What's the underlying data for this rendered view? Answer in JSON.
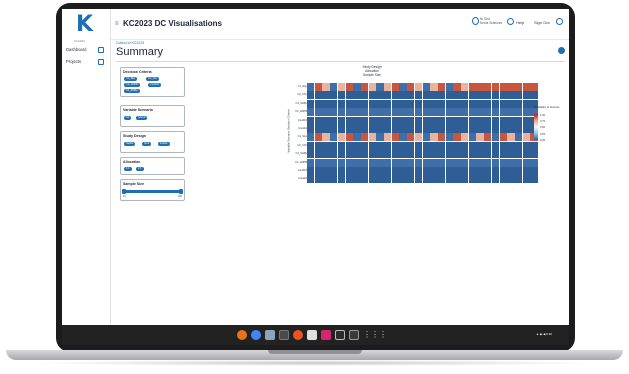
{
  "app": {
    "title": "KC2023 DC Visualisations",
    "logo_subtitle": "KC2023",
    "logo_letter": "K"
  },
  "nav": [
    {
      "label": "Dashboard",
      "icon": "grid-icon"
    },
    {
      "label": "Projects",
      "icon": "folder-icon"
    }
  ],
  "header": {
    "user_name": "Ni Gha",
    "user_org": "Kerva Sciences",
    "help_label": "Help",
    "signout_label": "Sign Out"
  },
  "breadcrumb": "Collect to KC2023",
  "page_title": "Summary",
  "filters": {
    "decision_criteria": {
      "title": "Decision Criteria",
      "chips": [
        "C1_Bkp",
        "C2_Ctb",
        "C3_ADPB",
        "Cond10",
        "C4_RDBp"
      ]
    },
    "variable_scenario": {
      "title": "Variable Scenario",
      "chips": [
        "S1",
        "Scen2"
      ]
    },
    "study_design": {
      "title": "Study Design",
      "chips": [
        "Subtle",
        "Vin1",
        "Fssfss"
      ]
    },
    "allocation": {
      "title": "Allocation",
      "chips": [
        "1:1",
        "2:1"
      ]
    },
    "sample_size": {
      "title": "Sample Size",
      "min": "10",
      "max": "100",
      "range_fraction": [
        0.0,
        1.0
      ]
    }
  },
  "heatmap": {
    "title_lines": [
      "Study Design",
      "Allocation",
      "Sample Size"
    ],
    "y_axis_label": "Variable Scenario Decision Criteria",
    "legend_title": "Probability of Success",
    "legend_ticks": [
      "1.00",
      "0.75",
      "0.50",
      "0.25",
      "0.00"
    ],
    "row_labels": [
      "C1_SLp",
      "C2_CTp",
      "C3_SHPp",
      "C4_ADPB",
      "Cond10",
      "Cond11",
      "C1_SLp",
      "C2_CTp",
      "C3_SHPp",
      "C4_ADPB",
      "Cond10",
      "Cond11"
    ],
    "colors": {
      "high": "#c8553d",
      "mid": "#e8b4a0",
      "low": "#3f6fa8",
      "lowdark": "#2f5d96"
    }
  },
  "taskbar": {
    "tray_text": "▲ ◆ ◀ 6:30"
  }
}
